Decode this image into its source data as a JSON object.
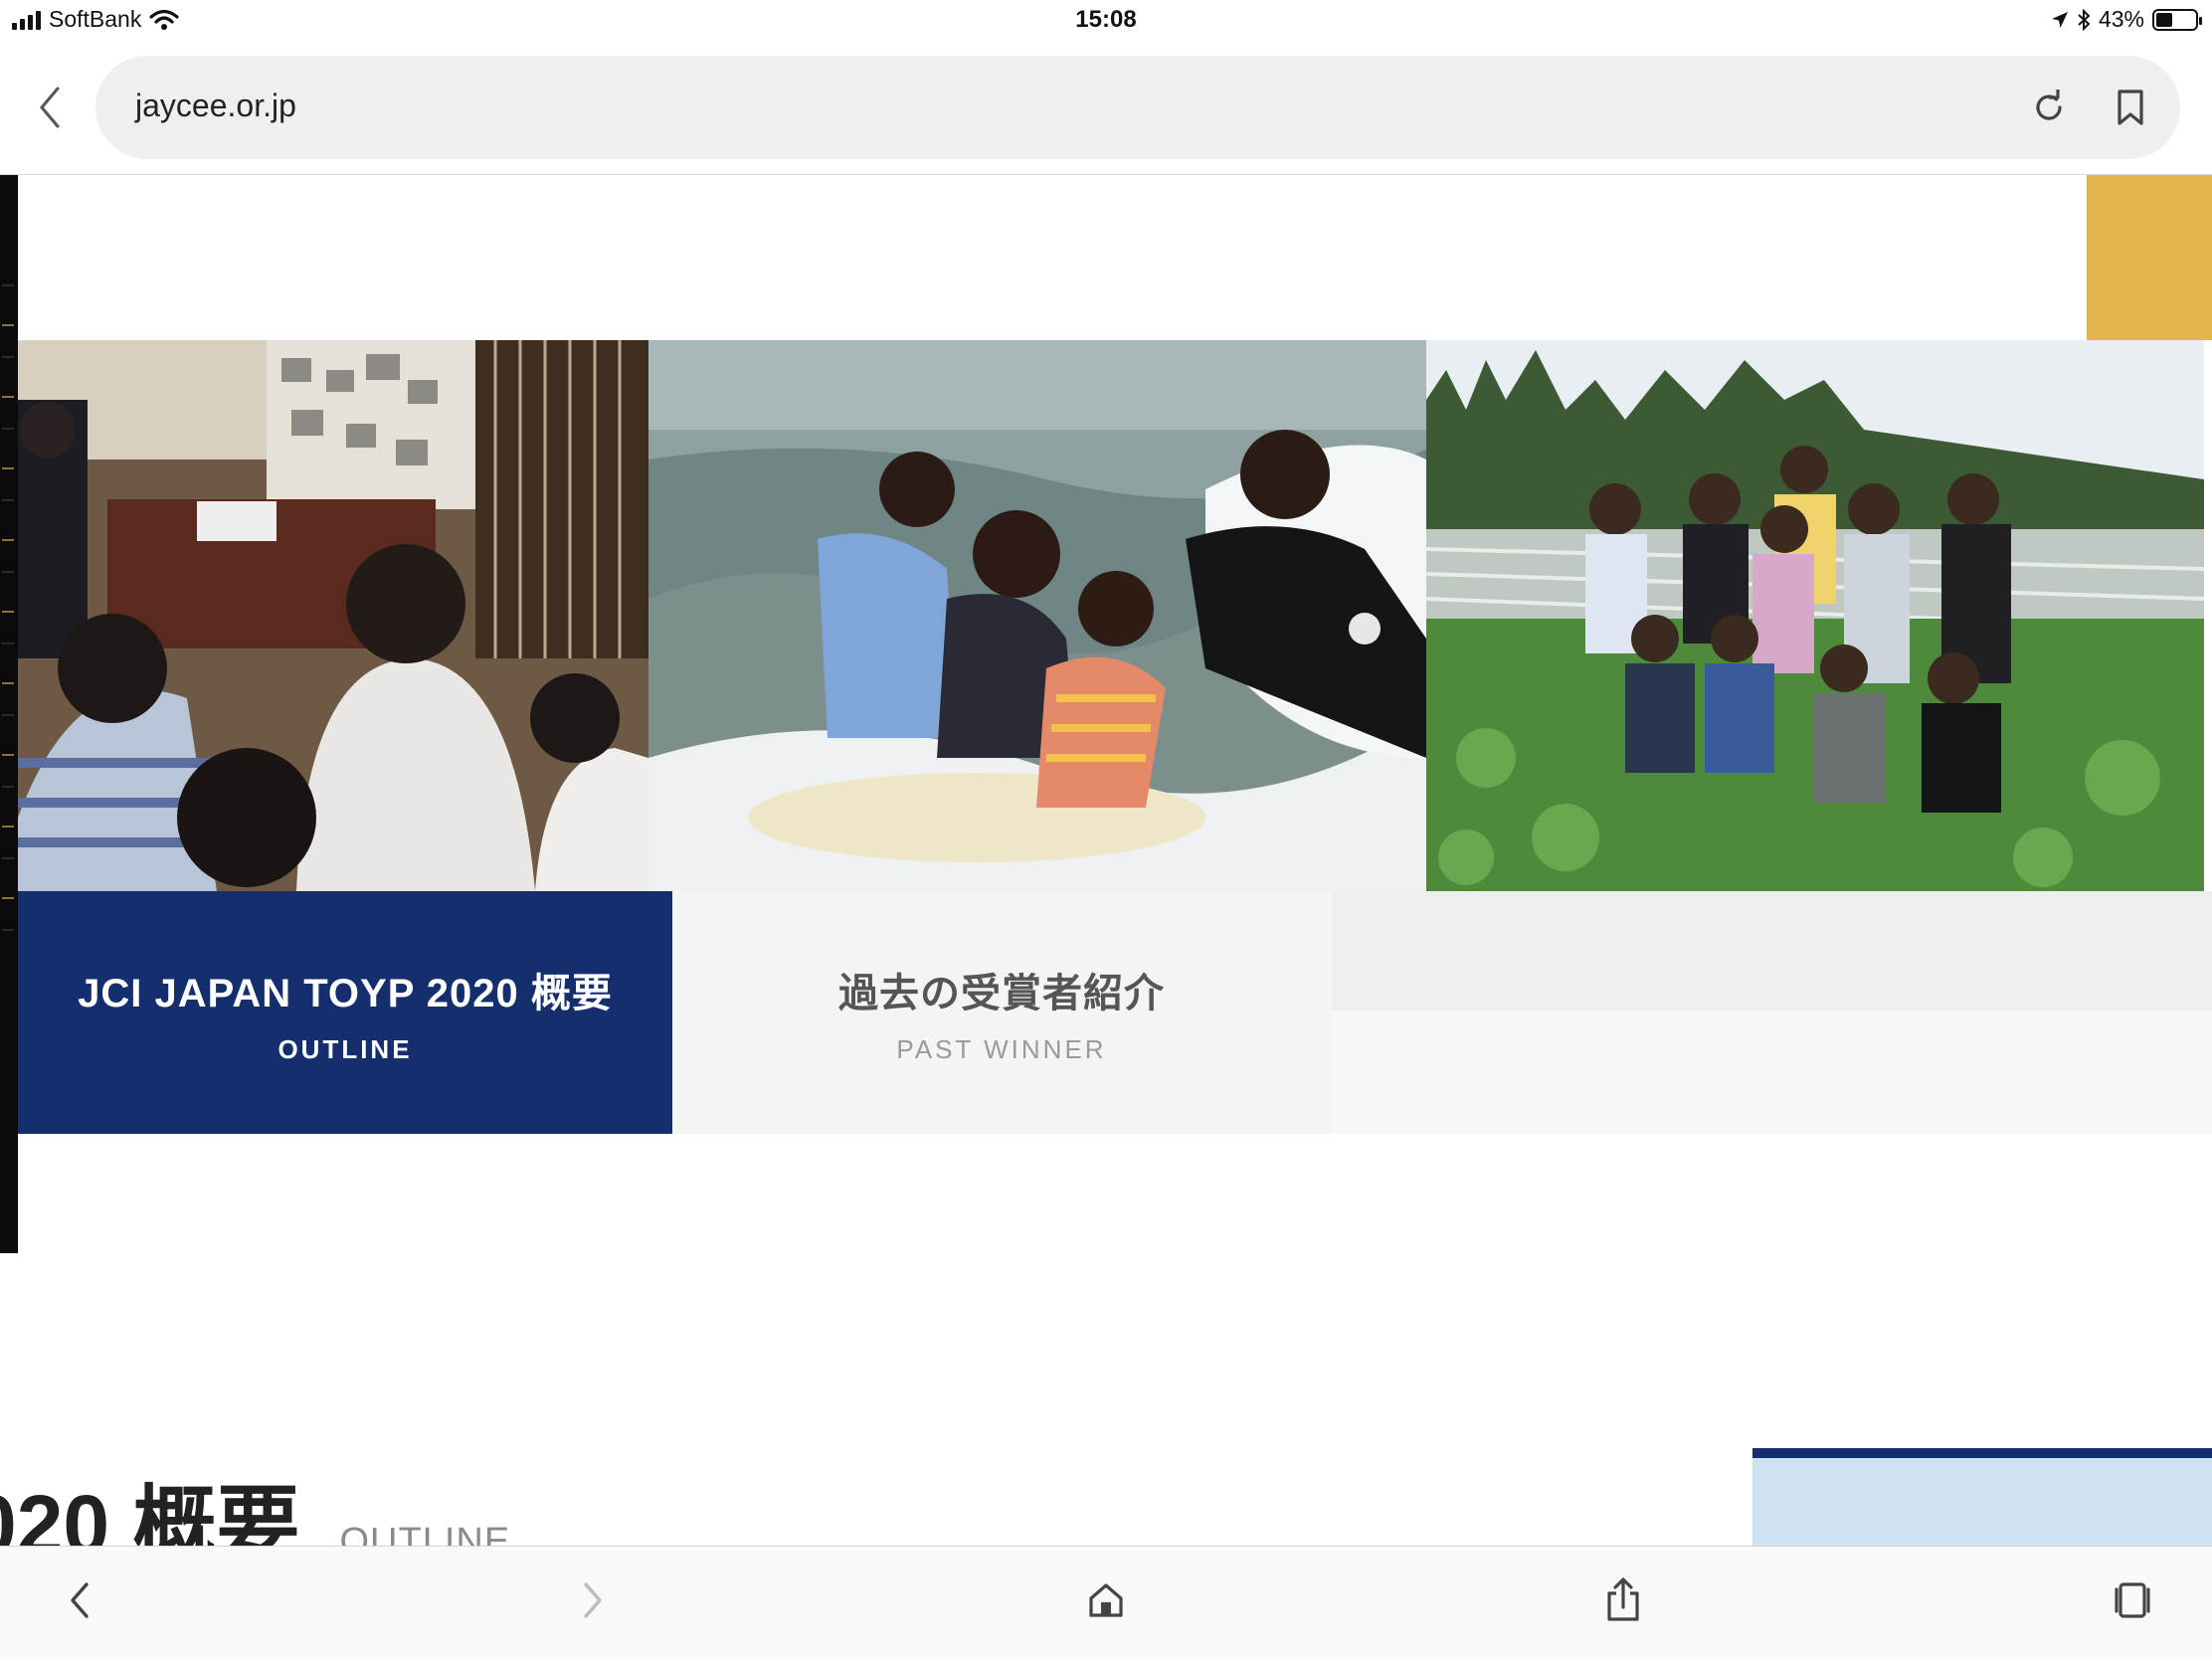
{
  "status_bar": {
    "carrier": "SoftBank",
    "time": "15:08",
    "battery_percent_label": "43%",
    "battery_level": 0.43
  },
  "address_bar": {
    "url": "jaycee.or.jp"
  },
  "tiles": {
    "outline": {
      "title": "JCI JAPAN TOYP 2020 概要",
      "subtitle": "OUTLINE"
    },
    "past_winner": {
      "title": "過去の受賞者紹介",
      "subtitle": "PAST WINNER"
    }
  },
  "section": {
    "heading": "020 概要",
    "subheading": "OUTLINE"
  },
  "colors": {
    "navy": "#142e6e",
    "gold": "#e2b44a",
    "light_gray": "#f4f4f4",
    "light_blue": "#cfe2f2"
  },
  "icons": [
    "wifi-icon",
    "location-arrow-icon",
    "bluetooth-icon",
    "battery-icon",
    "back-chevron-icon",
    "reload-icon",
    "bookmark-icon",
    "nav-back-icon",
    "nav-forward-icon",
    "home-icon",
    "share-icon",
    "tabs-icon"
  ]
}
